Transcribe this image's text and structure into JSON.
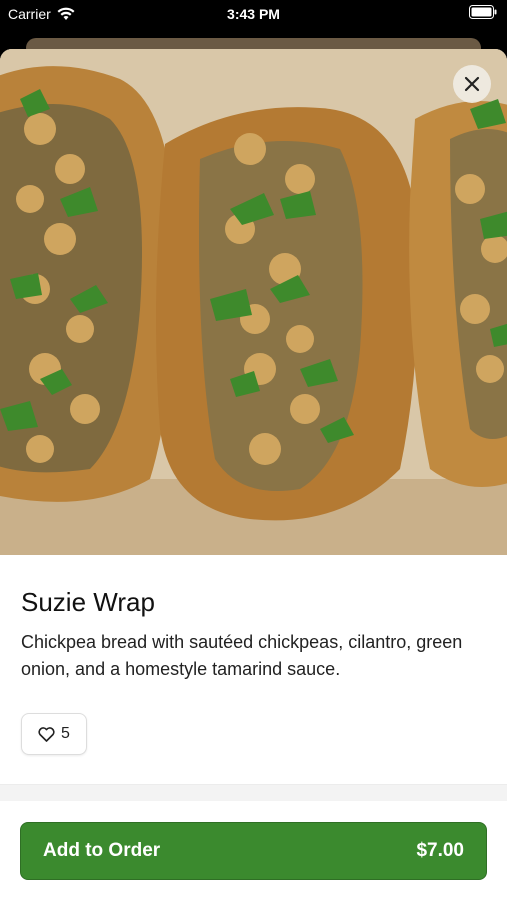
{
  "status_bar": {
    "carrier": "Carrier",
    "time": "3:43 PM"
  },
  "item": {
    "title": "Suzie Wrap",
    "description": "Chickpea bread with sautéed chickpeas, cilantro, green onion, and a homestyle tamarind sauce.",
    "likes": "5"
  },
  "order_button": {
    "label": "Add to Order",
    "price": "$7.00"
  },
  "colors": {
    "accent": "#3b8a2e",
    "background": "#ffffff"
  }
}
